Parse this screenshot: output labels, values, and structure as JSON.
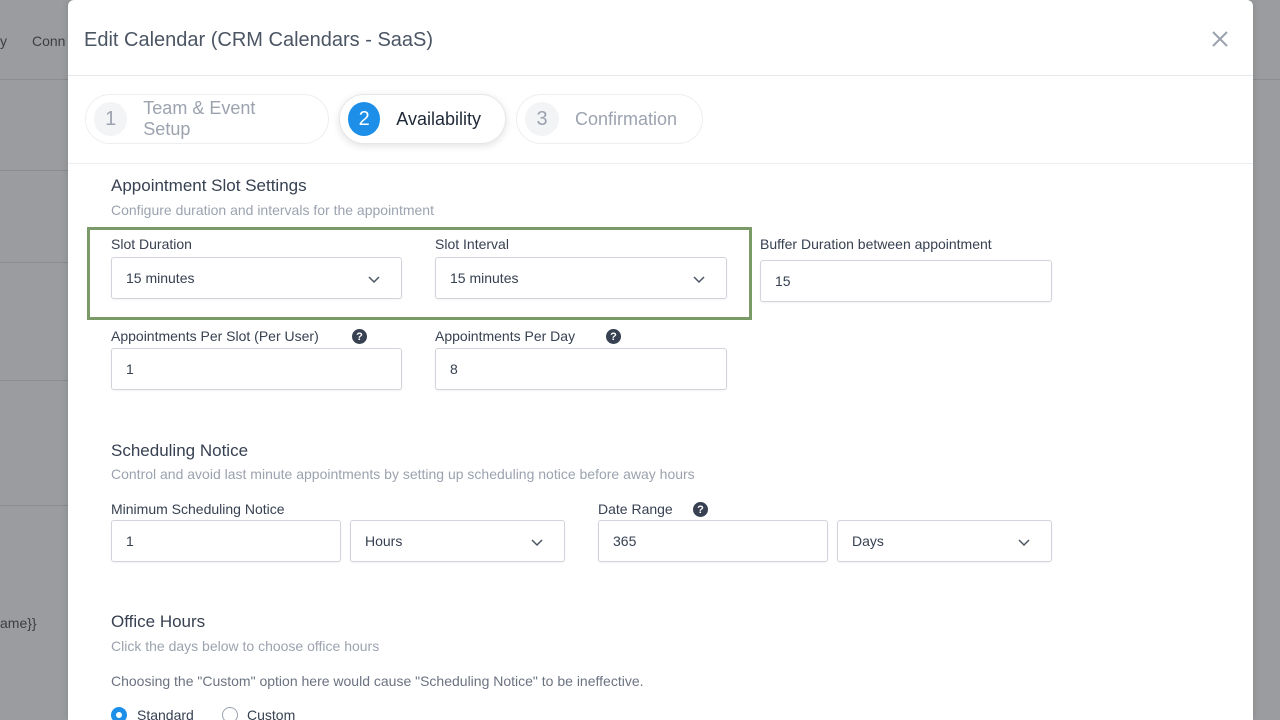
{
  "background": {
    "frag1": "y",
    "frag2": "Conn",
    "frag3": "ame}}"
  },
  "modal": {
    "title": "Edit Calendar (CRM Calendars - SaaS)",
    "close_icon": "close-icon"
  },
  "steps": [
    {
      "number": "1",
      "label": "Team & Event Setup"
    },
    {
      "number": "2",
      "label": "Availability"
    },
    {
      "number": "3",
      "label": "Confirmation"
    }
  ],
  "slot_settings": {
    "title": "Appointment Slot Settings",
    "subtitle": "Configure duration and intervals for the appointment",
    "slot_duration": {
      "label": "Slot Duration",
      "value": "15 minutes"
    },
    "slot_interval": {
      "label": "Slot Interval",
      "value": "15 minutes"
    },
    "buffer_duration": {
      "label": "Buffer Duration between appointment",
      "value": "15"
    },
    "per_slot": {
      "label": "Appointments Per Slot (Per User)",
      "value": "1"
    },
    "per_day": {
      "label": "Appointments Per Day",
      "value": "8"
    }
  },
  "scheduling_notice": {
    "title": "Scheduling Notice",
    "subtitle": "Control and avoid last minute appointments by setting up scheduling notice before away hours",
    "min_notice": {
      "label": "Minimum Scheduling Notice",
      "value": "1",
      "unit": "Hours"
    },
    "date_range": {
      "label": "Date Range",
      "value": "365",
      "unit": "Days"
    }
  },
  "office_hours": {
    "title": "Office Hours",
    "subtitle": "Click the days below to choose office hours",
    "note": "Choosing the \"Custom\" option here would cause \"Scheduling Notice\" to be ineffective.",
    "options": [
      "Standard",
      "Custom"
    ],
    "selected": "Standard"
  },
  "colors": {
    "accent": "#1d8fe8",
    "highlight": "#7a9a68"
  }
}
